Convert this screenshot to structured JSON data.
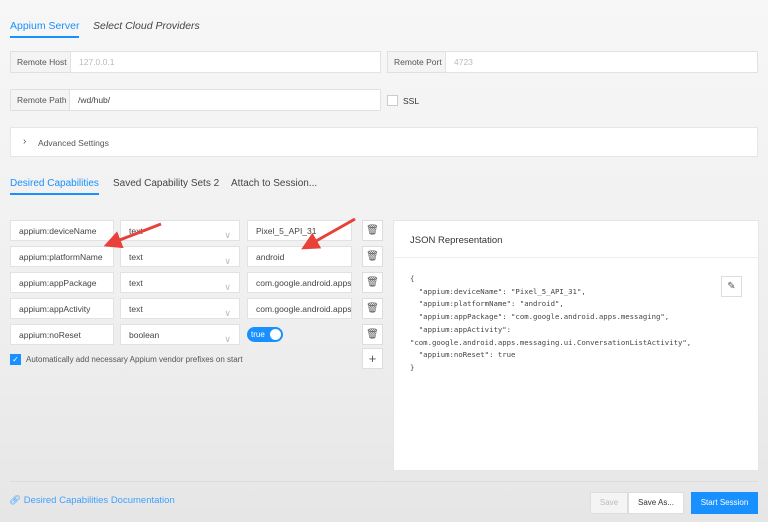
{
  "server_tabs": {
    "appium_server": "Appium Server",
    "cloud": "Select Cloud Providers"
  },
  "server": {
    "remote_host_label": "Remote Host",
    "remote_host_placeholder": "127.0.0.1",
    "remote_port_label": "Remote Port",
    "remote_port_placeholder": "4723",
    "remote_path_label": "Remote Path",
    "remote_path_value": "/wd/hub/",
    "ssl_label": "SSL",
    "ssl_checked": false,
    "advanced_settings": "Advanced Settings"
  },
  "cap_tabs": {
    "desired": "Desired Capabilities",
    "saved": "Saved Capability Sets 2",
    "attach": "Attach to Session..."
  },
  "capabilities": [
    {
      "name": "appium:deviceName",
      "type": "text",
      "value": "Pixel_5_API_31"
    },
    {
      "name": "appium:platformName",
      "type": "text",
      "value": "android"
    },
    {
      "name": "appium:appPackage",
      "type": "text",
      "value": "com.google.android.apps.messaging"
    },
    {
      "name": "appium:appActivity",
      "type": "text",
      "value": "com.google.android.apps.messaging.ui.ConversationListActivity"
    },
    {
      "name": "appium:noReset",
      "type": "boolean",
      "value": "true"
    }
  ],
  "auto_prefix_label": "Automatically add necessary Appium vendor prefixes on start",
  "auto_prefix_checked": true,
  "json_panel": {
    "title": "JSON Representation",
    "code": "{\n  \"appium:deviceName\": \"Pixel_5_API_31\",\n  \"appium:platformName\": \"android\",\n  \"appium:appPackage\": \"com.google.android.apps.messaging\",\n  \"appium:appActivity\":\n\"com.google.android.apps.messaging.ui.ConversationListActivity\",\n  \"appium:noReset\": true\n}"
  },
  "footer": {
    "doc_link": "Desired Capabilities Documentation",
    "save": "Save",
    "save_as": "Save As...",
    "start": "Start Session"
  },
  "colors": {
    "accent": "#1890ff",
    "annotation_arrow": "#e8413a"
  }
}
